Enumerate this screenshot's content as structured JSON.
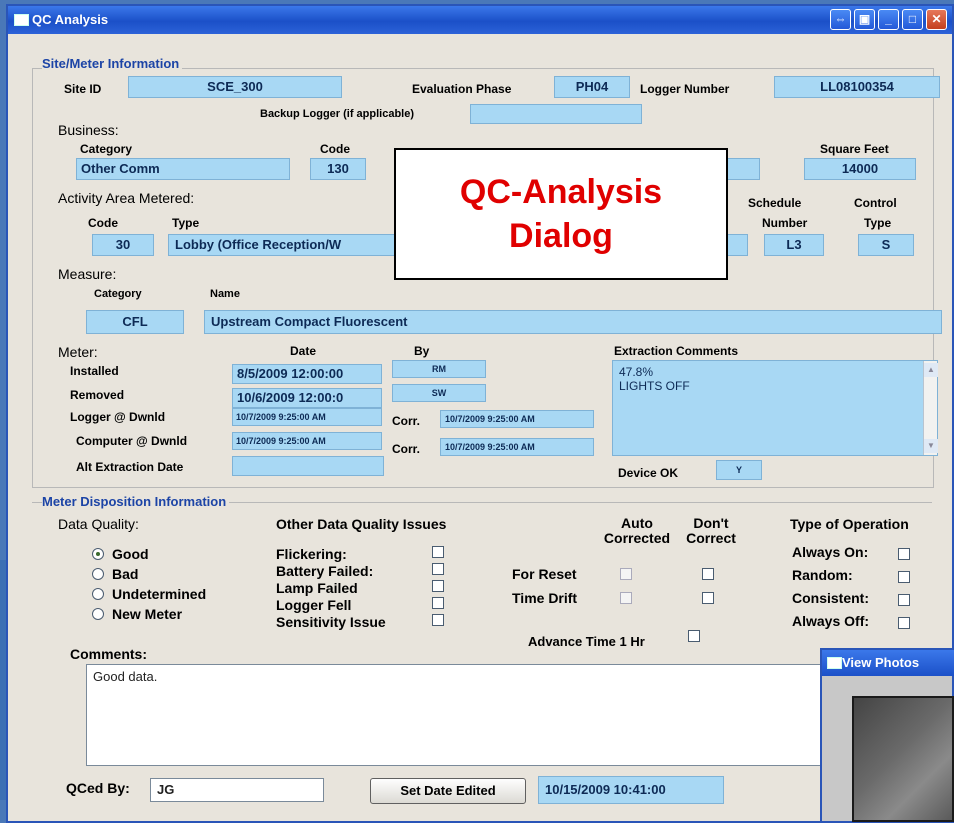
{
  "window": {
    "title": "QC Analysis"
  },
  "site": {
    "group_title": "Site/Meter Information",
    "site_id_label": "Site ID",
    "site_id": "SCE_300",
    "eval_phase_label": "Evaluation Phase",
    "eval_phase": "PH04",
    "logger_number_label": "Logger Number",
    "logger_number": "LL08100354",
    "backup_logger_label": "Backup Logger (if applicable)",
    "backup_logger": ""
  },
  "business": {
    "label": "Business:",
    "category_label": "Category",
    "category": "Other Comm",
    "code_label": "Code",
    "code": "130",
    "sqft_label": "Square Feet",
    "sqft": "14000"
  },
  "activity": {
    "label": "Activity Area Metered:",
    "code_label": "Code",
    "code": "30",
    "type_label": "Type",
    "type": "Lobby (Office Reception/W",
    "schedule_label": "Schedule",
    "number_label": "Number",
    "schedule_number": "L3",
    "control_label": "Control",
    "type_label2": "Type",
    "control_type": "S"
  },
  "measure": {
    "label": "Measure:",
    "category_label": "Category",
    "category": "CFL",
    "name_label": "Name",
    "name": "Upstream Compact Fluorescent"
  },
  "meter": {
    "label": "Meter:",
    "date_label": "Date",
    "by_label": "By",
    "installed_label": "Installed",
    "installed_date": "8/5/2009 12:00:00",
    "installed_by": "RM",
    "removed_label": "Removed",
    "removed_date": "10/6/2009 12:00:0",
    "removed_by": "SW",
    "logger_dwnld_label": "Logger @ Dwnld",
    "logger_dwnld": "10/7/2009 9:25:00 AM",
    "corr_label": "Corr.",
    "logger_corr": "10/7/2009 9:25:00 AM",
    "computer_dwnld_label": "Computer @ Dwnld",
    "computer_dwnld": "10/7/2009 9:25:00 AM",
    "computer_corr": "10/7/2009 9:25:00 AM",
    "alt_extraction_label": "Alt Extraction Date",
    "alt_extraction": "",
    "extraction_comments_label": "Extraction Comments",
    "extraction_line1": "47.8%",
    "extraction_line2": "LIGHTS OFF",
    "device_ok_label": "Device OK",
    "device_ok": "Y"
  },
  "overlay": {
    "line1": "QC-Analysis",
    "line2": "Dialog"
  },
  "disposition": {
    "group_title": "Meter Disposition Information",
    "data_quality_label": "Data Quality:",
    "quality_options": [
      "Good",
      "Bad",
      "Undetermined",
      "New Meter"
    ],
    "selected_quality": "Good",
    "other_issues_label": "Other Data Quality Issues",
    "issues": [
      "Flickering:",
      "Battery Failed:",
      "Lamp Failed",
      "Logger Fell",
      "Sensitivity Issue"
    ],
    "auto_corrected_label1": "Auto",
    "auto_corrected_label2": "Corrected",
    "dont_correct_label1": "Don't",
    "dont_correct_label2": "Correct",
    "for_reset_label": "For Reset",
    "time_drift_label": "Time Drift",
    "advance_time_label": "Advance Time 1 Hr",
    "type_of_operation_label": "Type of Operation",
    "operations": [
      "Always On:",
      "Random:",
      "Consistent:",
      "Always Off:"
    ],
    "comments_label": "Comments:",
    "comments": "Good data.",
    "qced_by_label": "QCed By:",
    "qced_by": "JG",
    "set_date_button": "Set Date Edited",
    "date_edited": "10/15/2009 10:41:00"
  },
  "photos_window": {
    "title": "View Photos"
  }
}
